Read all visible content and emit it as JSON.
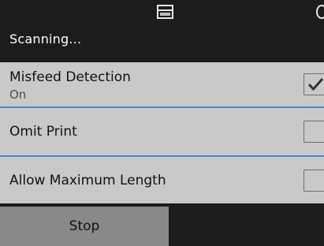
{
  "header": {
    "status": "Scanning...",
    "window_icon": "window-icon"
  },
  "settings": [
    {
      "label": "Misfeed Detection",
      "value": "On",
      "checked": true
    },
    {
      "label": "Omit Print",
      "checked": false
    },
    {
      "label": "Allow Maximum Length",
      "checked": false
    }
  ],
  "footer": {
    "stop_label": "Stop"
  },
  "colors": {
    "background": "#1c1c1c",
    "list_background": "#c9c9c9",
    "divider": "#4a88c8",
    "button": "#898989"
  }
}
